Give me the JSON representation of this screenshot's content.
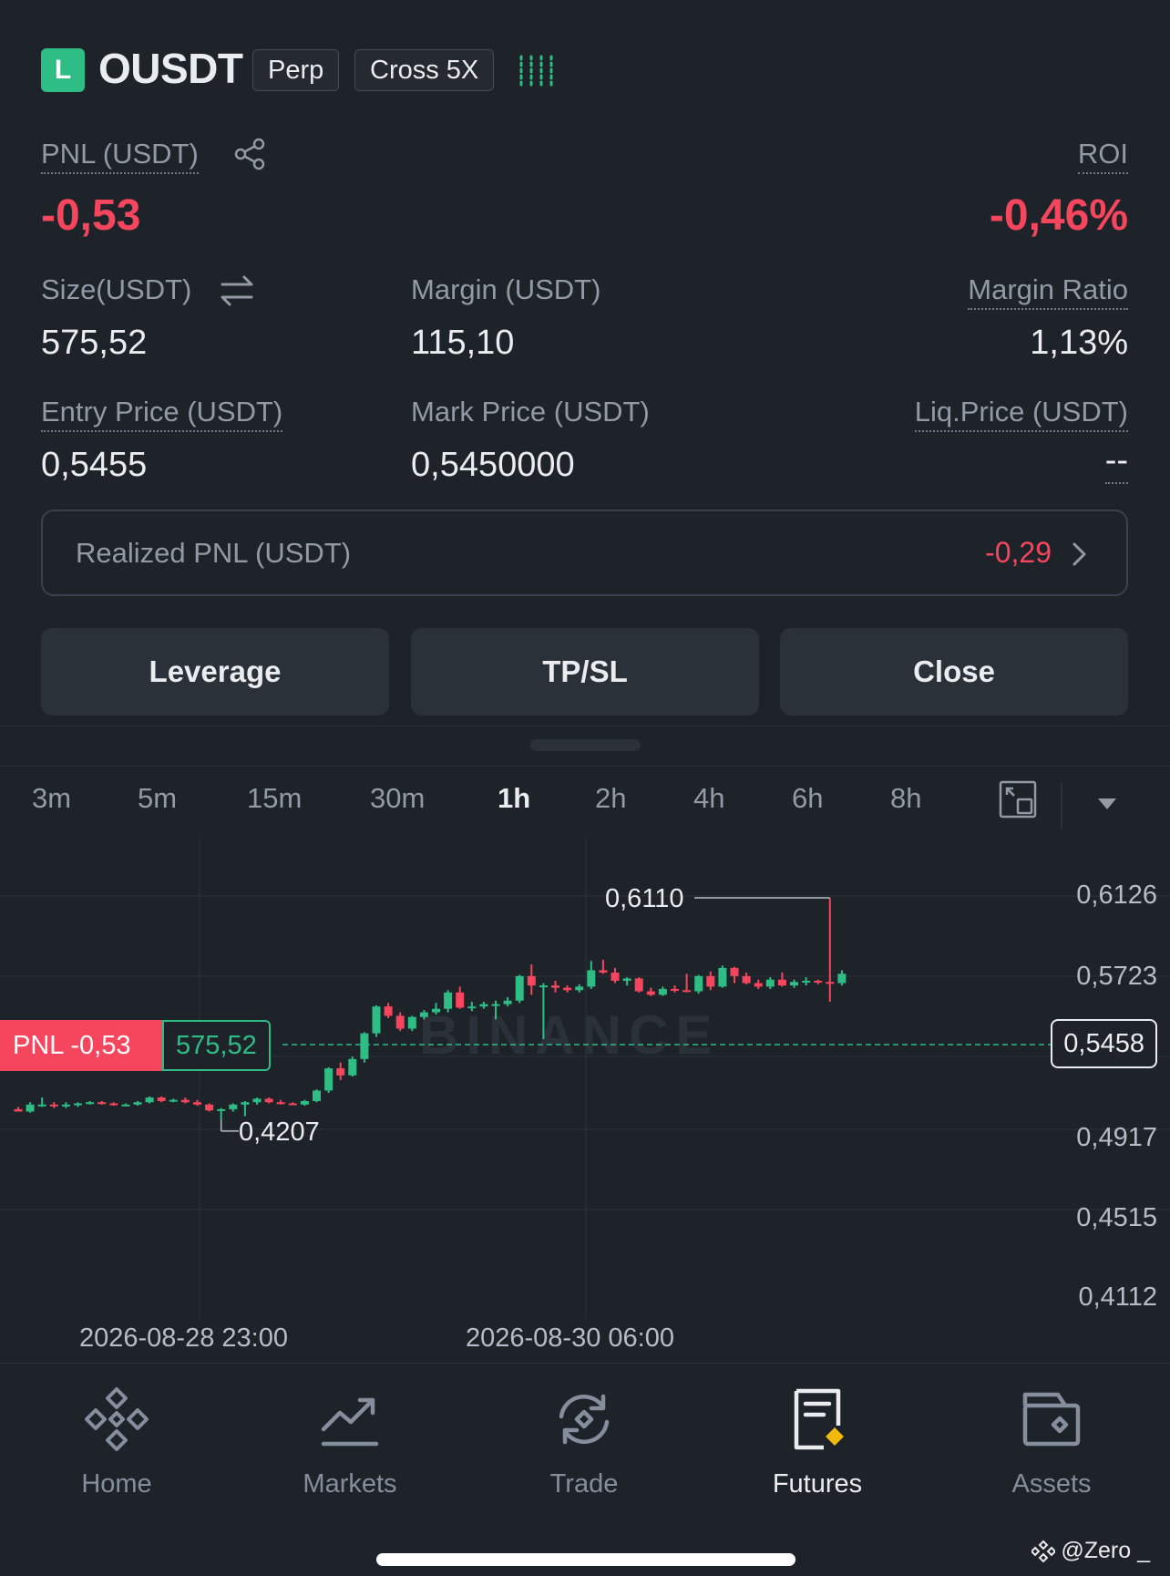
{
  "header": {
    "side_badge": "L",
    "symbol": "OUSDT",
    "type_tag": "Perp",
    "margin_tag": "Cross 5X"
  },
  "position": {
    "pnl_label": "PNL (USDT)",
    "pnl_value": "-0,53",
    "roi_label": "ROI",
    "roi_value": "-0,46%",
    "size_label": "Size(USDT)",
    "size_value": "575,52",
    "margin_label": "Margin (USDT)",
    "margin_value": "115,10",
    "margin_ratio_label": "Margin Ratio",
    "margin_ratio_value": "1,13%",
    "entry_label": "Entry Price (USDT)",
    "entry_value": "0,5455",
    "mark_label": "Mark Price (USDT)",
    "mark_value": "0,5450000",
    "liq_label": "Liq.Price (USDT)",
    "liq_value": "--",
    "realized_label": "Realized PNL (USDT)",
    "realized_value": "-0,29"
  },
  "actions": {
    "leverage": "Leverage",
    "tpsl": "TP/SL",
    "close": "Close"
  },
  "timeframes": [
    "3m",
    "5m",
    "15m",
    "30m",
    "1h",
    "2h",
    "4h",
    "6h",
    "8h"
  ],
  "active_timeframe": "1h",
  "chart_data": {
    "type": "candlestick",
    "y_ticks": [
      "0,6126",
      "0,5723",
      "0,4917",
      "0,4515",
      "0,4112"
    ],
    "x_ticks": [
      "2026-08-28 23:00",
      "2026-08-30 06:00"
    ],
    "ylim": [
      0.4112,
      0.6126
    ],
    "high_label": "0,6110",
    "low_label": "0,4207",
    "current_price_label": "0,5458",
    "pnl_tag": "PNL -0,53",
    "size_tag": "575,52",
    "watermark": "BINANCE",
    "colors": {
      "up": "#2ebd85",
      "down": "#f6465d"
    },
    "candles": [
      {
        "o": 0.43,
        "h": 0.432,
        "l": 0.428,
        "c": 0.428
      },
      {
        "o": 0.428,
        "h": 0.436,
        "l": 0.427,
        "c": 0.434
      },
      {
        "o": 0.434,
        "h": 0.44,
        "l": 0.432,
        "c": 0.434
      },
      {
        "o": 0.434,
        "h": 0.436,
        "l": 0.431,
        "c": 0.433
      },
      {
        "o": 0.433,
        "h": 0.436,
        "l": 0.431,
        "c": 0.434
      },
      {
        "o": 0.434,
        "h": 0.436,
        "l": 0.432,
        "c": 0.435
      },
      {
        "o": 0.435,
        "h": 0.437,
        "l": 0.434,
        "c": 0.436
      },
      {
        "o": 0.436,
        "h": 0.437,
        "l": 0.434,
        "c": 0.435
      },
      {
        "o": 0.435,
        "h": 0.436,
        "l": 0.433,
        "c": 0.434
      },
      {
        "o": 0.434,
        "h": 0.435,
        "l": 0.433,
        "c": 0.434
      },
      {
        "o": 0.434,
        "h": 0.437,
        "l": 0.433,
        "c": 0.436
      },
      {
        "o": 0.436,
        "h": 0.441,
        "l": 0.435,
        "c": 0.44
      },
      {
        "o": 0.44,
        "h": 0.441,
        "l": 0.436,
        "c": 0.437
      },
      {
        "o": 0.437,
        "h": 0.439,
        "l": 0.436,
        "c": 0.438
      },
      {
        "o": 0.438,
        "h": 0.44,
        "l": 0.435,
        "c": 0.436
      },
      {
        "o": 0.436,
        "h": 0.438,
        "l": 0.433,
        "c": 0.434
      },
      {
        "o": 0.434,
        "h": 0.435,
        "l": 0.428,
        "c": 0.429
      },
      {
        "o": 0.429,
        "h": 0.431,
        "l": 0.4207,
        "c": 0.43
      },
      {
        "o": 0.43,
        "h": 0.435,
        "l": 0.428,
        "c": 0.434
      },
      {
        "o": 0.434,
        "h": 0.437,
        "l": 0.424,
        "c": 0.436
      },
      {
        "o": 0.436,
        "h": 0.44,
        "l": 0.434,
        "c": 0.439
      },
      {
        "o": 0.439,
        "h": 0.44,
        "l": 0.435,
        "c": 0.436
      },
      {
        "o": 0.436,
        "h": 0.438,
        "l": 0.434,
        "c": 0.435
      },
      {
        "o": 0.435,
        "h": 0.436,
        "l": 0.434,
        "c": 0.434
      },
      {
        "o": 0.434,
        "h": 0.438,
        "l": 0.433,
        "c": 0.437
      },
      {
        "o": 0.437,
        "h": 0.447,
        "l": 0.436,
        "c": 0.446
      },
      {
        "o": 0.446,
        "h": 0.466,
        "l": 0.444,
        "c": 0.465
      },
      {
        "o": 0.465,
        "h": 0.47,
        "l": 0.455,
        "c": 0.459
      },
      {
        "o": 0.459,
        "h": 0.475,
        "l": 0.458,
        "c": 0.473
      },
      {
        "o": 0.473,
        "h": 0.496,
        "l": 0.47,
        "c": 0.495
      },
      {
        "o": 0.495,
        "h": 0.519,
        "l": 0.492,
        "c": 0.518
      },
      {
        "o": 0.518,
        "h": 0.521,
        "l": 0.508,
        "c": 0.51
      },
      {
        "o": 0.51,
        "h": 0.513,
        "l": 0.497,
        "c": 0.499
      },
      {
        "o": 0.499,
        "h": 0.51,
        "l": 0.497,
        "c": 0.509
      },
      {
        "o": 0.509,
        "h": 0.515,
        "l": 0.507,
        "c": 0.513
      },
      {
        "o": 0.513,
        "h": 0.521,
        "l": 0.511,
        "c": 0.516
      },
      {
        "o": 0.516,
        "h": 0.532,
        "l": 0.513,
        "c": 0.53
      },
      {
        "o": 0.53,
        "h": 0.535,
        "l": 0.516,
        "c": 0.517
      },
      {
        "o": 0.517,
        "h": 0.522,
        "l": 0.514,
        "c": 0.518
      },
      {
        "o": 0.518,
        "h": 0.522,
        "l": 0.516,
        "c": 0.52
      },
      {
        "o": 0.52,
        "h": 0.523,
        "l": 0.507,
        "c": 0.52
      },
      {
        "o": 0.52,
        "h": 0.526,
        "l": 0.518,
        "c": 0.523
      },
      {
        "o": 0.523,
        "h": 0.545,
        "l": 0.521,
        "c": 0.544
      },
      {
        "o": 0.544,
        "h": 0.554,
        "l": 0.528,
        "c": 0.536
      },
      {
        "o": 0.536,
        "h": 0.538,
        "l": 0.49,
        "c": 0.536
      },
      {
        "o": 0.536,
        "h": 0.54,
        "l": 0.53,
        "c": 0.534
      },
      {
        "o": 0.534,
        "h": 0.536,
        "l": 0.53,
        "c": 0.532
      },
      {
        "o": 0.532,
        "h": 0.537,
        "l": 0.53,
        "c": 0.535
      },
      {
        "o": 0.535,
        "h": 0.557,
        "l": 0.533,
        "c": 0.549
      },
      {
        "o": 0.549,
        "h": 0.558,
        "l": 0.546,
        "c": 0.547
      },
      {
        "o": 0.547,
        "h": 0.551,
        "l": 0.538,
        "c": 0.54
      },
      {
        "o": 0.54,
        "h": 0.543,
        "l": 0.536,
        "c": 0.542
      },
      {
        "o": 0.542,
        "h": 0.543,
        "l": 0.53,
        "c": 0.531
      },
      {
        "o": 0.531,
        "h": 0.534,
        "l": 0.527,
        "c": 0.528
      },
      {
        "o": 0.528,
        "h": 0.535,
        "l": 0.527,
        "c": 0.533
      },
      {
        "o": 0.533,
        "h": 0.536,
        "l": 0.53,
        "c": 0.532
      },
      {
        "o": 0.532,
        "h": 0.546,
        "l": 0.53,
        "c": 0.531
      },
      {
        "o": 0.531,
        "h": 0.545,
        "l": 0.529,
        "c": 0.544
      },
      {
        "o": 0.544,
        "h": 0.548,
        "l": 0.532,
        "c": 0.535
      },
      {
        "o": 0.535,
        "h": 0.553,
        "l": 0.534,
        "c": 0.551
      },
      {
        "o": 0.551,
        "h": 0.552,
        "l": 0.538,
        "c": 0.544
      },
      {
        "o": 0.544,
        "h": 0.547,
        "l": 0.537,
        "c": 0.538
      },
      {
        "o": 0.538,
        "h": 0.541,
        "l": 0.533,
        "c": 0.535
      },
      {
        "o": 0.535,
        "h": 0.543,
        "l": 0.533,
        "c": 0.541
      },
      {
        "o": 0.541,
        "h": 0.547,
        "l": 0.535,
        "c": 0.536
      },
      {
        "o": 0.536,
        "h": 0.541,
        "l": 0.534,
        "c": 0.539
      },
      {
        "o": 0.539,
        "h": 0.543,
        "l": 0.536,
        "c": 0.54
      },
      {
        "o": 0.54,
        "h": 0.541,
        "l": 0.537,
        "c": 0.539
      },
      {
        "o": 0.539,
        "h": 0.611,
        "l": 0.522,
        "c": 0.538
      },
      {
        "o": 0.538,
        "h": 0.549,
        "l": 0.536,
        "c": 0.546
      }
    ]
  },
  "nav": {
    "home": "Home",
    "markets": "Markets",
    "trade": "Trade",
    "futures": "Futures",
    "assets": "Assets"
  },
  "watermark_user": "@Zero _"
}
